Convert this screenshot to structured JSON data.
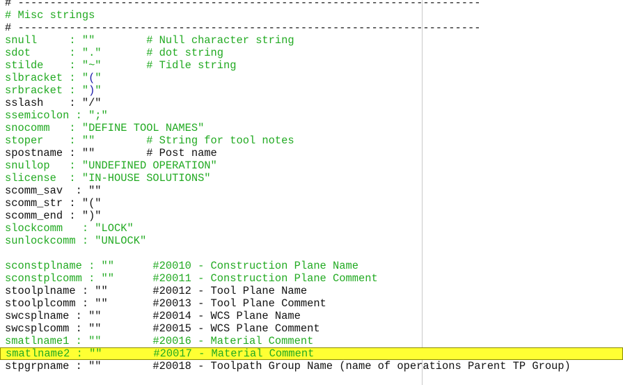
{
  "colors": {
    "green": "#22aa22",
    "black": "#111111",
    "blue": "#1a1aaa",
    "highlight": "#ffff33",
    "margin": "#c8c8c8"
  },
  "editor": {
    "highlighted_line": 28,
    "lines": [
      [
        [
          "# ------------------------------------------------------------------------",
          "black"
        ]
      ],
      [
        [
          "# Misc strings",
          "green"
        ]
      ],
      [
        [
          "# ------------------------------------------------------------------------",
          "black"
        ]
      ],
      [
        [
          "snull     : \"\"        # Null character string",
          "green"
        ]
      ],
      [
        [
          "sdot      : \".\"       # dot string",
          "green"
        ]
      ],
      [
        [
          "stilde    : \"~\"       # Tidle string",
          "green"
        ]
      ],
      [
        [
          "slbracket : \"",
          "green"
        ],
        [
          "(",
          "blue"
        ],
        [
          "\"",
          "green"
        ]
      ],
      [
        [
          "srbracket : \"",
          "green"
        ],
        [
          ")",
          "blue"
        ],
        [
          "\"",
          "green"
        ]
      ],
      [
        [
          "sslash    : \"/\"",
          "black"
        ]
      ],
      [
        [
          "ssemicolon : \";\"",
          "green"
        ]
      ],
      [
        [
          "snocomm   : \"DEFINE TOOL NAMES\"",
          "green"
        ]
      ],
      [
        [
          "stoper    : \"\"        # String for tool notes",
          "green"
        ]
      ],
      [
        [
          "spostname : \"\"        # Post name",
          "black"
        ]
      ],
      [
        [
          "snullop   : \"UNDEFINED OPERATION\"",
          "green"
        ]
      ],
      [
        [
          "slicense  : \"IN-HOUSE SOLUTIONS\"",
          "green"
        ]
      ],
      [
        [
          "scomm_sav  : \"\"",
          "black"
        ]
      ],
      [
        [
          "scomm_str : \"(\"",
          "black"
        ]
      ],
      [
        [
          "scomm_end : \")\"",
          "black"
        ]
      ],
      [
        [
          "slockcomm   : \"LOCK\"",
          "green"
        ]
      ],
      [
        [
          "sunlockcomm : \"UNLOCK\"",
          "green"
        ]
      ],
      [],
      [
        [
          "sconstplname : \"\"      #20010 - Construction Plane Name",
          "green"
        ]
      ],
      [
        [
          "sconstplcomm : \"\"      #20011 - Construction Plane Comment",
          "green"
        ]
      ],
      [
        [
          "stoolplname : \"\"       #20012 - Tool Plane Name",
          "black"
        ]
      ],
      [
        [
          "stoolplcomm : \"\"       #20013 - Tool Plane Comment",
          "black"
        ]
      ],
      [
        [
          "swcsplname : \"\"        #20014 - WCS Plane Name",
          "black"
        ]
      ],
      [
        [
          "swcsplcomm : \"\"        #20015 - WCS Plane Comment",
          "black"
        ]
      ],
      [
        [
          "smatlname1 : \"\"        #20016 - Material Comment",
          "green"
        ]
      ],
      [
        [
          "smatlname2 : \"\"        #20017 - Material Comment",
          "green"
        ]
      ],
      [
        [
          "stpgrpname : \"\"        #20018 - Toolpath Group Name (name of operations Parent TP Group)",
          "black"
        ]
      ]
    ]
  }
}
